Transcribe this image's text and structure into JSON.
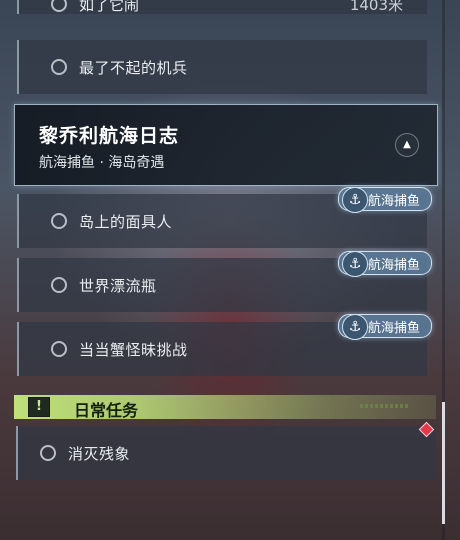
{
  "top_partial": {
    "label": "如了它闹",
    "distance": "1403米"
  },
  "quests_before": [
    {
      "label": "最了不起的机兵"
    }
  ],
  "group": {
    "title": "黎乔利航海日志",
    "subtitle": "航海捕鱼 · 海岛奇遇"
  },
  "group_quests": [
    {
      "label": "岛上的面具人",
      "tag": "航海捕鱼"
    },
    {
      "label": "世界漂流瓶",
      "tag": "航海捕鱼"
    },
    {
      "label": "当当蟹怪昧挑战",
      "tag": "航海捕鱼"
    }
  ],
  "daily": {
    "label": "日常任务",
    "icon": "!"
  },
  "daily_quests": [
    {
      "label": "消灭残象"
    }
  ],
  "icons": {
    "collapse": "chevron-up-icon",
    "tag": "anchor-icon",
    "daily": "exclamation-icon",
    "tracked": "diamond-marker-icon"
  },
  "colors": {
    "daily_accent": "#bfe07a",
    "tag_bg": "#5a7896",
    "marker": "#e23a4a"
  }
}
